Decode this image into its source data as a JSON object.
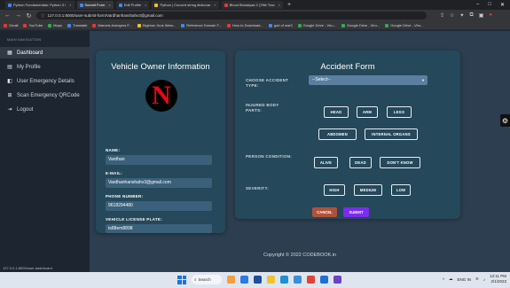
{
  "browser": {
    "tabs": [
      {
        "label": "Python Fundamentals: Python 3 /",
        "active": false
      },
      {
        "label": "Submit Form",
        "active": true
      },
      {
        "label": "Edit Profile",
        "active": false
      },
      {
        "label": "Python | Convert string dictionar",
        "active": false
      },
      {
        "label": "Bhool Bhulaiyaa 2 (Title Trac",
        "active": false
      }
    ],
    "url": "127.0.0.1:8000/user-submit-form/Vardhanhanshahv3@gmail.com",
    "bookmarks": [
      "Gmail",
      "YouTube",
      "Maps",
      "Translate",
      "Marvels Avengers F...",
      "Digimon Xros Wars...",
      "Reference Domain T...",
      "How to Download...",
      "god of war3",
      "Google Drive - Viru...",
      "Google Drive - Viru...",
      "Google Drive - Viru..."
    ]
  },
  "sidebar": {
    "heading": "MAIN NAVIGATION",
    "items": [
      {
        "label": "Dashboard",
        "icon": "dashboard-icon",
        "active": true
      },
      {
        "label": "My Profile",
        "icon": "profile-icon",
        "active": false
      },
      {
        "label": "User Emergency Details",
        "icon": "details-icon",
        "active": false
      },
      {
        "label": "Scan Emergency QRCode",
        "icon": "qrcode-icon",
        "active": false
      },
      {
        "label": "Logout",
        "icon": "logout-icon",
        "active": false
      }
    ],
    "status_url": "127.0.0.1:8000/user-dashboard"
  },
  "owner": {
    "title": "Vehicle Owner Information",
    "logo_letter": "N",
    "fields": [
      {
        "label": "NAME:",
        "value": "Vardhan"
      },
      {
        "label": "E-MAIL:",
        "value": "Vardhanhanshahv3@gmail.com"
      },
      {
        "label": "PHONE NUMBER:",
        "value": "9618294480"
      },
      {
        "label": "VEHICLE LICENSE PLATE:",
        "value": "ts88em8898"
      }
    ]
  },
  "accident": {
    "title": "Accident Form",
    "accident_type_label": "CHOOSE ACCIDENT TYPE:",
    "accident_type_value": "--Select--",
    "injured_label": "INJURED BODY PARTS:",
    "injured_parts": [
      "HEAD",
      "ARM",
      "LEGS",
      "ABDOMEN",
      "INTERNAL ORGANS"
    ],
    "condition_label": "PERSON CONDITION:",
    "conditions": [
      "ALIVE",
      "DEAD",
      "DON'T KNOW"
    ],
    "severity_label": "SEVERITY:",
    "severities": [
      "HIGH",
      "MEDIUM",
      "LOW"
    ],
    "cancel_label": "CANCEL",
    "submit_label": "SUBMIT"
  },
  "footer": {
    "text": "Copyright © 2022 CODEBOOK.in"
  },
  "taskbar": {
    "search_label": "Search",
    "lang": "ENG IN",
    "time": "12:11 PM",
    "date": "2/1/2023"
  },
  "colors": {
    "accent": "#7b2cf0",
    "cancel": "#b0523a",
    "card": "#25485a",
    "page": "#2c3e50"
  }
}
